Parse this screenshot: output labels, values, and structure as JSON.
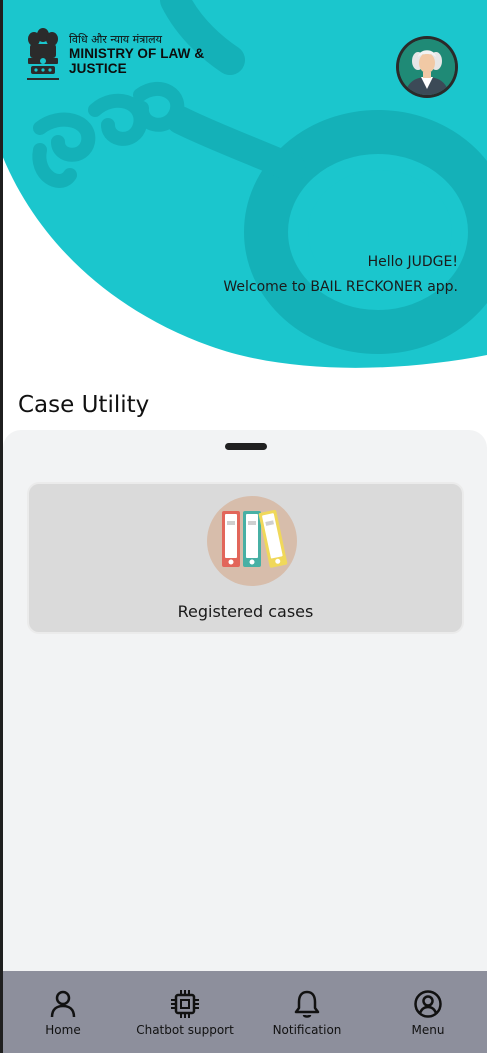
{
  "header": {
    "ministry_hindi": "विधि और न्याय मंत्रालय",
    "ministry_line1": "MINISTRY OF LAW &",
    "ministry_line2": "JUSTICE",
    "greeting": "Hello JUDGE!",
    "welcome": "Welcome to BAIL RECKONER app.",
    "accent_color": "#1bc6cd"
  },
  "main": {
    "section_title": "Case Utility",
    "cards": [
      {
        "label": "Registered cases",
        "icon": "binders-icon"
      }
    ]
  },
  "bottom_nav": {
    "items": [
      {
        "label": "Home",
        "icon": "person-icon"
      },
      {
        "label": "Chatbot support",
        "icon": "chip-icon"
      },
      {
        "label": "Notification",
        "icon": "bell-icon"
      },
      {
        "label": "Menu",
        "icon": "account-circle-icon"
      }
    ]
  }
}
